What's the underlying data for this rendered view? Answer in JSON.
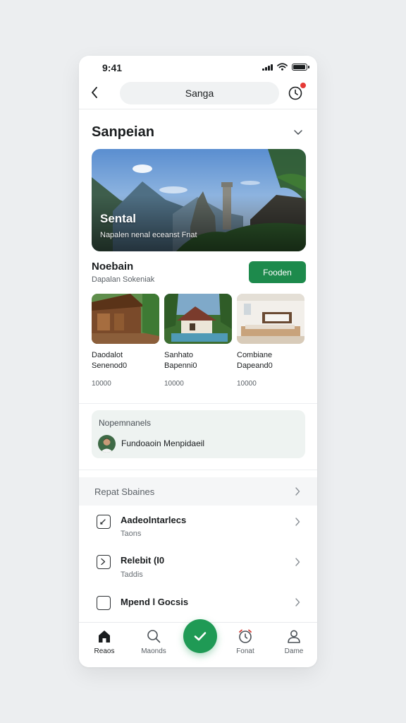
{
  "status": {
    "time": "9:41"
  },
  "topbar": {
    "search_text": "Sanga"
  },
  "section": {
    "title": "Sanpeian"
  },
  "hero": {
    "title": "Sental",
    "subtitle": "Napalen nenal eceanst Fnat"
  },
  "featured": {
    "title": "Noebain",
    "subtitle": "Dapalan Sokeniak",
    "button_label": "Fooden"
  },
  "cards": [
    {
      "title": "Daodalot",
      "subtitle": "Senenod0",
      "value": "10000"
    },
    {
      "title": "Sanhato",
      "subtitle": "Bapenni0",
      "value": "10000"
    },
    {
      "title": "Combiane",
      "subtitle": "Dapeand0",
      "value": "10000"
    }
  ],
  "profile": {
    "label": "Nopemnanels",
    "name": "Fundoaoin Menpidaeil"
  },
  "list": {
    "header": "Repat Sbaines",
    "items": [
      {
        "title": "Aadeolntarlecs",
        "subtitle": "Taons"
      },
      {
        "title": "Relebit (I0",
        "subtitle": "Taddis"
      },
      {
        "title": "Mpend l Gocsis",
        "subtitle": ""
      }
    ]
  },
  "tabs": [
    {
      "label": "Reaos",
      "icon": "home-icon"
    },
    {
      "label": "Maonds",
      "icon": "search-icon"
    },
    {
      "label": "Fonat",
      "icon": "alarm-icon"
    },
    {
      "label": "Dame",
      "icon": "profile-icon"
    }
  ],
  "colors": {
    "accent": "#1d8a4c",
    "fab": "#1f9a55",
    "badge": "#e53935"
  }
}
